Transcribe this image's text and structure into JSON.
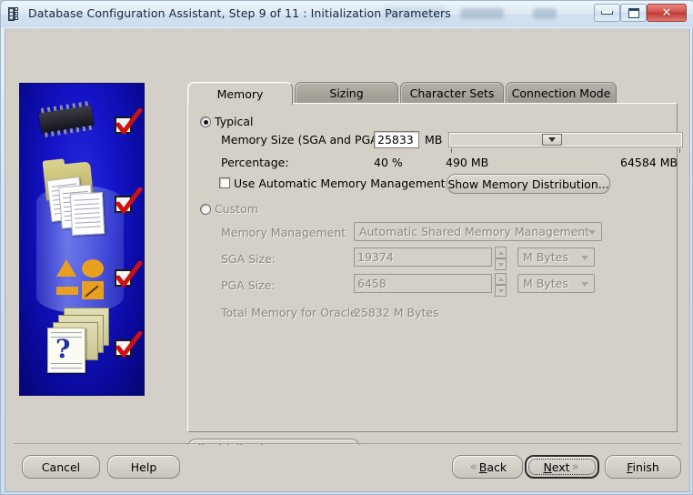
{
  "window": {
    "title": "Database Configuration Assistant, Step 9 of 11 : Initialization Parameters",
    "icon": "database-assistant-icon",
    "minimize_label": "Minimize",
    "maximize_label": "Maximize",
    "close_label": "✕"
  },
  "banner": {
    "name": "oracle-dbca-illustration",
    "checkmarks": 4
  },
  "tabs": [
    {
      "label": "Memory",
      "selected": true
    },
    {
      "label": "Sizing",
      "selected": false
    },
    {
      "label": "Character Sets",
      "selected": false
    },
    {
      "label": "Connection Mode",
      "selected": false
    }
  ],
  "memory_tab": {
    "typical": {
      "label": "Typical",
      "selected": true,
      "memory_size_label": "Memory Size (SGA and PGA):",
      "memory_size_value": "25833",
      "memory_size_unit": "MB",
      "percentage_label": "Percentage:",
      "percentage_value": "40 %",
      "slider_min_label": "490 MB",
      "slider_max_label": "64584 MB",
      "slider_position_percent": 40,
      "amm_checkbox_label": "Use Automatic Memory Management",
      "amm_checked": false,
      "show_distribution_button": "Show Memory Distribution..."
    },
    "custom": {
      "label": "Custom",
      "selected": false,
      "memory_management_label": "Memory Management",
      "memory_management_value": "Automatic Shared Memory Management",
      "sga_label": "SGA Size:",
      "sga_value": "19374",
      "sga_unit": "M Bytes",
      "pga_label": "PGA Size:",
      "pga_value": "6458",
      "pga_unit": "M Bytes",
      "total_label": "Total Memory for Oracle:",
      "total_value": "25832 M Bytes"
    }
  },
  "all_params_button": "All Initialization Parameters...",
  "footer": {
    "cancel": "Cancel",
    "help": "Help",
    "back": "Back",
    "back_mnemonic": "B",
    "next": "Next",
    "next_mnemonic": "N",
    "finish": "Finish",
    "finish_mnemonic": "F",
    "back_chevron": "«",
    "next_chevron": "»"
  },
  "colors": {
    "dialog_face": "#d4d0c8",
    "banner_blue": "#1414c8",
    "checkmark_red": "#cc1111",
    "close_red": "#d4524c"
  }
}
